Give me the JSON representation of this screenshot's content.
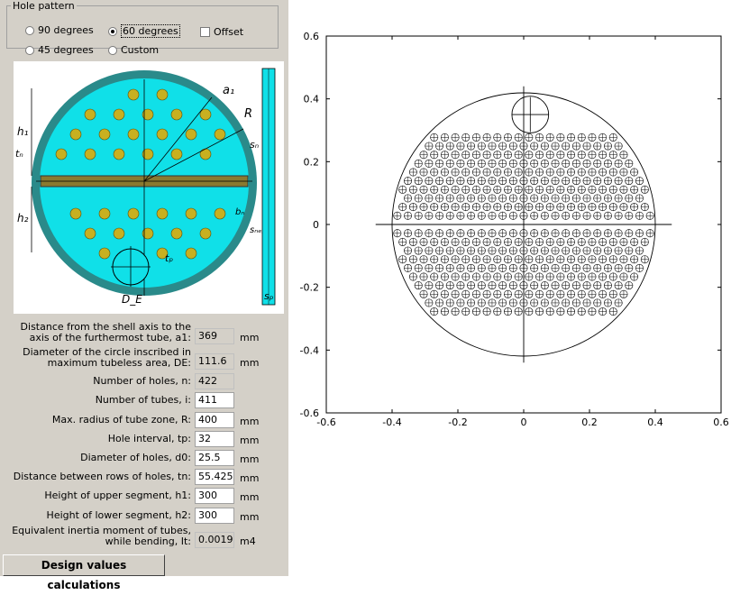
{
  "hole_pattern": {
    "title": "Hole pattern",
    "options": [
      {
        "label": "90 degrees",
        "selected": false
      },
      {
        "label": "60 degrees",
        "selected": true
      },
      {
        "label": "45 degrees",
        "selected": false
      },
      {
        "label": "Custom",
        "selected": false
      }
    ],
    "offset": {
      "label": "Offset",
      "checked": false
    }
  },
  "schema_labels": {
    "a1": "a₁",
    "R": "R",
    "h1": "h₁",
    "h2": "h₂",
    "tn": "tₙ",
    "sn": "sₙ",
    "bn": "bₙ",
    "snep": "sₙₑₚ",
    "tp": "tₚ",
    "DE": "D_E",
    "sp": "sₚ"
  },
  "params": [
    {
      "label": "Distance from the shell axis to the axis of the furthermost tube, a1:",
      "value": "369",
      "unit": "mm",
      "readonly": true
    },
    {
      "label": "Diameter of the circle inscribed in maximum tubeless area, DE:",
      "value": "111.6",
      "unit": "mm",
      "readonly": true
    },
    {
      "label": "Number of holes, n:",
      "value": "422",
      "unit": "",
      "readonly": true
    },
    {
      "label": "Number of tubes, i:",
      "value": "411",
      "unit": "",
      "readonly": false
    },
    {
      "label": "Max. radius of tube zone, R:",
      "value": "400",
      "unit": "mm",
      "readonly": false
    },
    {
      "label": "Hole interval, tp:",
      "value": "32",
      "unit": "mm",
      "readonly": false
    },
    {
      "label": "Diameter of holes, d0:",
      "value": "25.5",
      "unit": "mm",
      "readonly": false
    },
    {
      "label": "Distance between rows of holes, tn:",
      "value": "55.4256",
      "unit": "mm",
      "readonly": false
    },
    {
      "label": "Height of upper segment, h1:",
      "value": "300",
      "unit": "mm",
      "readonly": false
    },
    {
      "label": "Height of lower segment, h2:",
      "value": "300",
      "unit": "mm",
      "readonly": false
    },
    {
      "label": "Equivalent inertia moment of tubes, while bending, It:",
      "value": "0.00194",
      "unit": "m4",
      "readonly": true
    }
  ],
  "calc_button": "Design values calculations",
  "plot": {
    "x_ticks": [
      "-0.6",
      "-0.4",
      "-0.2",
      "0",
      "0.2",
      "0.4",
      "0.6"
    ],
    "y_ticks": [
      "0.6",
      "0.4",
      "0.2",
      "0",
      "-0.2",
      "-0.4",
      "-0.6"
    ],
    "xlim": [
      -0.6,
      0.6
    ],
    "ylim": [
      -0.6,
      0.6
    ],
    "shell_radius": 0.4,
    "hole_diameter": 0.0255,
    "hole_interval": 0.032,
    "row_spacing": 0.0277,
    "upper_rows_y": [
      0.028,
      0.0557,
      0.0834,
      0.1111,
      0.1388,
      0.1665,
      0.1942,
      0.2219,
      0.2496,
      0.2773
    ],
    "lower_rows_y": [
      -0.028,
      -0.0557,
      -0.0834,
      -0.1111,
      -0.1388,
      -0.1665,
      -0.1942,
      -0.2219,
      -0.2496,
      -0.2773
    ],
    "tubeless_circle": {
      "x": 0.02,
      "y": 0.35,
      "r": 0.0558
    }
  }
}
